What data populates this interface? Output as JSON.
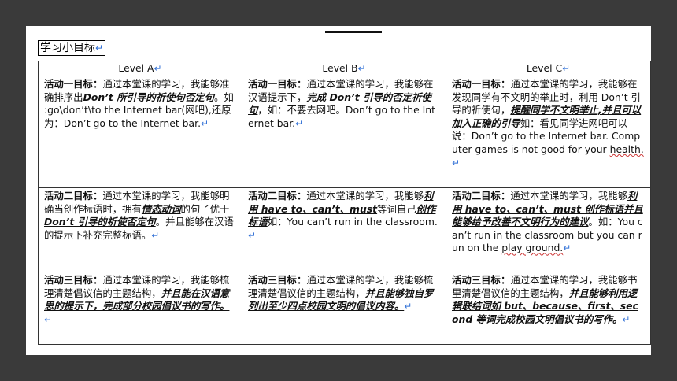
{
  "heading": "学习小目标",
  "para_mark": "↵",
  "columns": [
    "Level A",
    "Level B",
    "Level C"
  ],
  "rows": [
    {
      "cells": [
        {
          "label": "活动一目标：",
          "pre": "通过本堂课的学习，我能够准确排序出",
          "emph": "Don’t 所引导的祈使句否定句",
          "post": "。如 :go\\don’t\\to the Internet bar(网吧),还原为：Don’t go to the Internet bar.",
          "post2": "",
          "emph2": "",
          "post3": ""
        },
        {
          "label": "活动一目标：",
          "pre": "通过本堂课的学习，我能够在汉语提示下，",
          "emph": "完成 Don’t 引导的否定祈使句",
          "post": "，如：不要去网吧。Don’t go to the Internet bar.",
          "post2": "",
          "emph2": "",
          "post3": ""
        },
        {
          "label": "活动一目标：",
          "pre": "通过本堂课的学习，我能够在发现同学有不文明的举止时，利用 Don’t 引导的祈使句，",
          "emph": "提醒同学不文明举止,并且可以加入正确的引导",
          "post": "如：看见同学进网吧可以说：Don’t go to the Internet bar. Computer games is not good for your ",
          "post2": "health.",
          "emph2": "",
          "post3": ""
        }
      ]
    },
    {
      "cells": [
        {
          "label": "活动二目标：",
          "pre": "通过本堂课的学习，我能够明确当创作标语时，拥有",
          "emph": "情态动词",
          "post": "的句子优于 ",
          "emph2": "Don’t 引导的祈使否定句",
          "post3": "。并且能够在汉语的提示下补充完整标语。",
          "post2": ""
        },
        {
          "label": "活动二目标：",
          "pre": "通过本堂课的学习，我能够",
          "emph": "利用 have to、can’t、must",
          "post": "等词自己",
          "emph2": "创作标语",
          "post3": "如：You can’t run in the classroom.",
          "post2": ""
        },
        {
          "label": "活动二目标：",
          "pre": "通过本堂课的学习，我能够",
          "emph": "利用 have to、can’t、must 创作标语并且能够给予改善不文明行为的建议",
          "post": "。如：You can’t run in the classroom but you can run on the ",
          "emph2": "",
          "post3": "",
          "post2": "play ground."
        }
      ]
    },
    {
      "cells": [
        {
          "label": "活动三目标：",
          "pre": "通过本堂课的学习，我能够梳理清楚倡议信的主题结构，",
          "emph": "并且能在汉语意思的提示下，完成部分校园倡议书的写作。",
          "post": "",
          "emph2": "",
          "post3": "",
          "post2": ""
        },
        {
          "label": "活动三目标：",
          "pre": "通过本堂课的学习，我能够梳理清楚倡议信的主题结构，",
          "emph": "并且能够独自罗列出至少四点校园文明的倡议内容。",
          "post": "",
          "emph2": "",
          "post3": "",
          "post2": ""
        },
        {
          "label": "活动三目标：",
          "pre": "通过本堂课的学习，我能够书里清楚倡议信的主题结构，",
          "emph": "并且能够利用逻辑联结词如 but、because、first、second 等词完成校园文明倡议书的写作。",
          "post": "",
          "emph2": "",
          "post3": "",
          "post2": ""
        }
      ]
    }
  ]
}
